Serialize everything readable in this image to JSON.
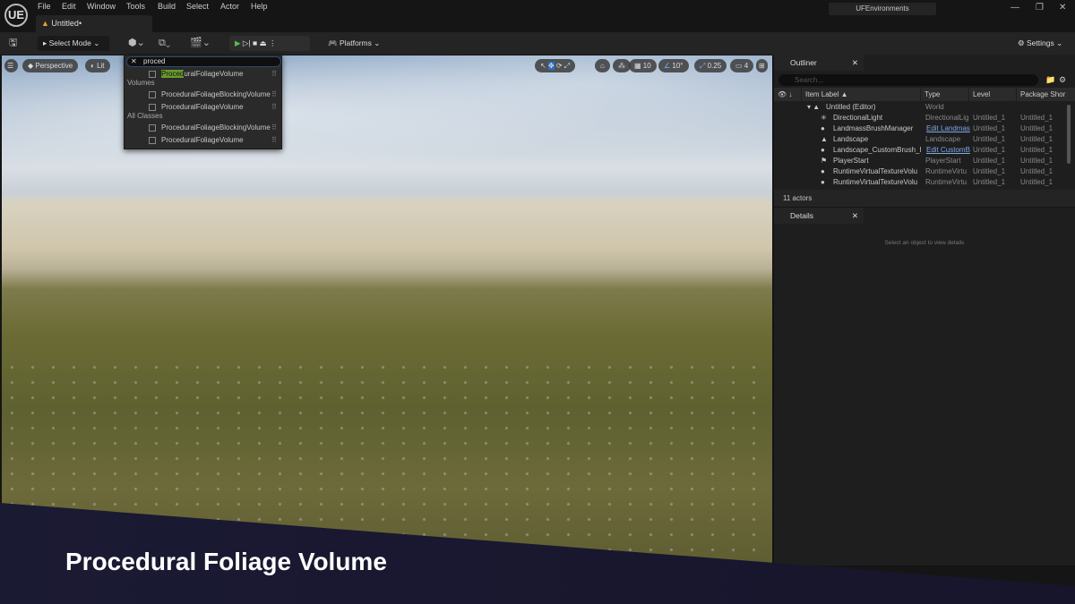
{
  "app": {
    "logo": "UE",
    "menu": [
      "File",
      "Edit",
      "Window",
      "Tools",
      "Build",
      "Select",
      "Actor",
      "Help"
    ],
    "tab": "Untitled•",
    "project": "UFEnvironments"
  },
  "toolbar": {
    "select_mode": "Select Mode",
    "platforms": "Platforms",
    "settings": "Settings"
  },
  "viewport": {
    "perspective": "Perspective",
    "lit": "Lit",
    "grid": "10",
    "angle": "10°",
    "scale": "0.25",
    "camera_speed": "4"
  },
  "search": {
    "query": "proced",
    "highlight": "Proced",
    "results": [
      {
        "category": "",
        "items": [
          "ProceduralFoliageVolume"
        ]
      },
      {
        "category": "Volumes",
        "items": [
          "ProceduralFoliageBlockingVolume",
          "ProceduralFoliageVolume"
        ]
      },
      {
        "category": "All Classes",
        "items": [
          "ProceduralFoliageBlockingVolume",
          "ProceduralFoliageVolume"
        ]
      }
    ]
  },
  "outliner": {
    "title": "Outliner",
    "search_placeholder": "Search...",
    "columns": [
      "Item Label ▲",
      "Type",
      "Level",
      "Package Shor"
    ],
    "rows": [
      {
        "label": "Untitled (Editor)",
        "type": "World",
        "level": "",
        "pkg": ""
      },
      {
        "label": "DirectionalLight",
        "type": "DirectionalLig",
        "level": "Untitled_1",
        "pkg": "Untitled_1"
      },
      {
        "label": "LandmassBrushManager",
        "type": "Edit Landmas",
        "level": "Untitled_1",
        "pkg": "Untitled_1"
      },
      {
        "label": "Landscape",
        "type": "Landscape",
        "level": "Untitled_1",
        "pkg": "Untitled_1"
      },
      {
        "label": "Landscape_CustomBrush_l",
        "type": "Edit CustomB",
        "level": "Untitled_1",
        "pkg": "Untitled_1"
      },
      {
        "label": "PlayerStart",
        "type": "PlayerStart",
        "level": "Untitled_1",
        "pkg": "Untitled_1"
      },
      {
        "label": "RuntimeVirtualTextureVolu",
        "type": "RuntimeVirtu",
        "level": "Untitled_1",
        "pkg": "Untitled_1"
      },
      {
        "label": "RuntimeVirtualTextureVolu",
        "type": "RuntimeVirtu",
        "level": "Untitled_1",
        "pkg": "Untitled_1"
      }
    ],
    "count": "11 actors"
  },
  "details": {
    "title": "Details",
    "empty": "Select an object to view details"
  },
  "banner": {
    "title": "Procedural Foliage Volume"
  }
}
